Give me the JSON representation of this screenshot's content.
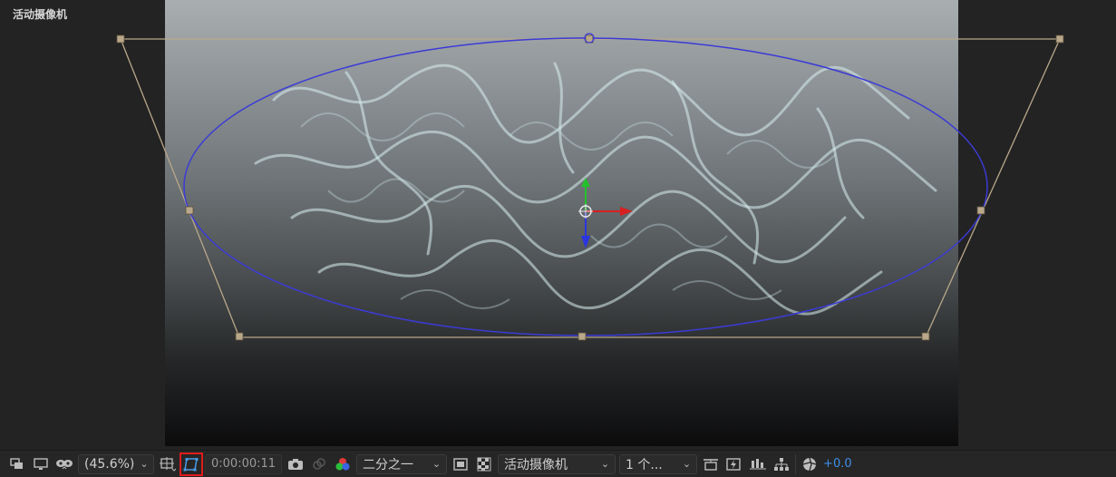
{
  "viewer": {
    "label": "活动摄像机"
  },
  "toolbar": {
    "magnification": "(45.6%)",
    "timecode": "0:00:00:11",
    "resolution": "二分之一",
    "camera": "活动摄像机",
    "views": "1 个...",
    "exposure": "+0.0"
  },
  "icons": [
    "always-preview-icon",
    "monitor-icon",
    "mask-visibility-icon",
    "grid-guides-icon",
    "camera-transform-icon",
    "snapshot-icon",
    "show-snapshot-icon",
    "color-channels-icon",
    "region-of-interest-icon",
    "transparency-grid-icon",
    "fast-previews-icon",
    "timeline-icon",
    "flowchart-icon",
    "reset-exposure-icon"
  ],
  "colors": {
    "accent": "#e01b1b",
    "exposure": "#3e8ee8",
    "ellipse": "#3b3bd6",
    "frame": "#b9a88a"
  }
}
